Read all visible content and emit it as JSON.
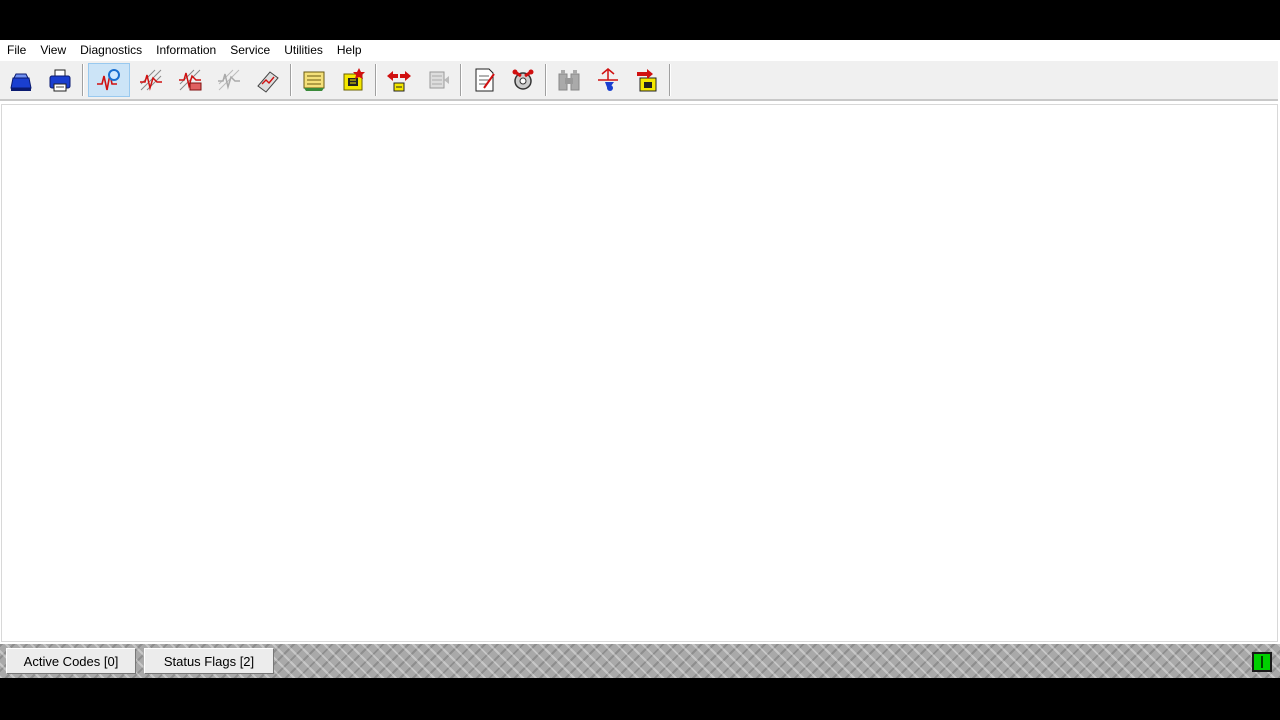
{
  "menubar": {
    "items": [
      {
        "label": "File"
      },
      {
        "label": "View"
      },
      {
        "label": "Diagnostics"
      },
      {
        "label": "Information"
      },
      {
        "label": "Service"
      },
      {
        "label": "Utilities"
      },
      {
        "label": "Help"
      }
    ]
  },
  "toolbar": {
    "groups": [
      [
        "connect-icon",
        "print-icon"
      ],
      [
        "diagnostics-monitor-icon",
        "data-monitor-icon",
        "dual-monitor-icon",
        "disabled-monitor-icon",
        "snapshot-icon"
      ],
      [
        "data-list-icon",
        "calibration-icon"
      ],
      [
        "data-transfer-icon",
        "disabled-transfer-icon"
      ],
      [
        "notes-icon",
        "service-tools-icon"
      ],
      [
        "disabled-tools-icon",
        "trip-info-icon",
        "export-icon"
      ]
    ],
    "active": "diagnostics-monitor-icon"
  },
  "statusbar": {
    "active_codes_label": "Active Codes [0]",
    "status_flags_label": "Status Flags [2]",
    "connection_color": "#00d000"
  },
  "colors": {
    "background": "#000000",
    "window": "#ffffff",
    "toolbar": "#f0f0f0",
    "active_button": "#cce4f7",
    "statusbar": "#a9a9a9"
  }
}
